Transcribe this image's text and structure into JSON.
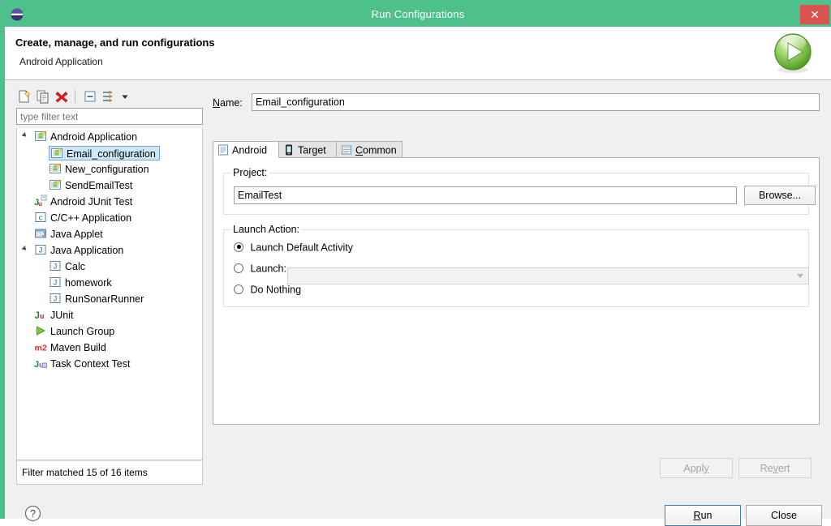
{
  "window": {
    "title": "Run Configurations",
    "app_icon": "eclipse-globe-icon",
    "close_label": "✕"
  },
  "banner": {
    "title": "Create, manage, and run configurations",
    "subtitle": "Android Application",
    "icon": "run-launch-icon"
  },
  "left_panel": {
    "toolbar": [
      {
        "name": "new-launch-configuration",
        "icon": "new-document-icon"
      },
      {
        "name": "duplicate-launch-configuration",
        "icon": "copy-icon"
      },
      {
        "name": "delete-launch-configuration",
        "icon": "red-x-delete-icon"
      },
      {
        "name": "collapse-all",
        "icon": "collapse-all-icon"
      },
      {
        "name": "filter-launch-configurations",
        "icon": "filter-icon"
      },
      {
        "name": "view-menu",
        "icon": "chevron-down-icon"
      }
    ],
    "filter": {
      "value": "type filter text",
      "placeholder": "type filter text"
    },
    "tree": [
      {
        "label": "Android Application",
        "icon": "android-config-icon",
        "indent": 0,
        "expanded": true,
        "selected": false
      },
      {
        "label": "Email_configuration",
        "icon": "android-config-icon",
        "indent": 1,
        "expanded": false,
        "selected": true
      },
      {
        "label": "New_configuration",
        "icon": "android-config-icon",
        "indent": 1,
        "expanded": false,
        "selected": false
      },
      {
        "label": "SendEmailTest",
        "icon": "android-config-icon",
        "indent": 1,
        "expanded": false,
        "selected": false
      },
      {
        "label": "Android JUnit Test",
        "icon": "android-junit-icon",
        "indent": 0,
        "expanded": false,
        "selected": false
      },
      {
        "label": "C/C++ Application",
        "icon": "c-application-icon",
        "indent": 0,
        "expanded": false,
        "selected": false
      },
      {
        "label": "Java Applet",
        "icon": "java-applet-icon",
        "indent": 0,
        "expanded": false,
        "selected": false
      },
      {
        "label": "Java Application",
        "icon": "java-application-icon",
        "indent": 0,
        "expanded": true,
        "selected": false
      },
      {
        "label": "Calc",
        "icon": "java-application-icon",
        "indent": 1,
        "expanded": false,
        "selected": false
      },
      {
        "label": "homework",
        "icon": "java-application-icon",
        "indent": 1,
        "expanded": false,
        "selected": false
      },
      {
        "label": "RunSonarRunner",
        "icon": "java-application-icon",
        "indent": 1,
        "expanded": false,
        "selected": false
      },
      {
        "label": "JUnit",
        "icon": "junit-icon",
        "indent": 0,
        "expanded": false,
        "selected": false
      },
      {
        "label": "Launch Group",
        "icon": "green-play-icon",
        "indent": 0,
        "expanded": false,
        "selected": false
      },
      {
        "label": "Maven Build",
        "icon": "maven-m2-icon",
        "indent": 0,
        "expanded": false,
        "selected": false
      },
      {
        "label": "Task Context Test",
        "icon": "task-context-junit-icon",
        "indent": 0,
        "expanded": false,
        "selected": false
      }
    ],
    "filter_status": "Filter matched 15 of 16 items"
  },
  "right_panel": {
    "name_label": "Name:",
    "name_label_mnemonic": "N",
    "name_value": "Email_configuration",
    "tabs": [
      {
        "label": "Android",
        "icon": "android-tab-icon",
        "active": true
      },
      {
        "label": "Target",
        "icon": "device-target-icon",
        "active": false
      },
      {
        "label": "Common",
        "icon": "common-tab-icon",
        "active": false,
        "mnemonic": "C"
      }
    ],
    "project_group": {
      "label": "Project:",
      "value": "EmailTest",
      "browse_label": "Browse..."
    },
    "launch_action_group": {
      "label": "Launch Action:",
      "options": [
        {
          "label": "Launch Default Activity",
          "checked": true
        },
        {
          "label": "Launch:",
          "checked": false
        },
        {
          "label": "Do Nothing",
          "checked": false
        }
      ],
      "launch_combo_value": "",
      "launch_combo_enabled": false
    },
    "apply_label": "Apply",
    "apply_mnemonic": "y",
    "apply_enabled": false,
    "revert_label": "Revert",
    "revert_mnemonic": "v",
    "revert_enabled": false
  },
  "footer": {
    "help_icon": "help-question-icon",
    "run_label": "Run",
    "run_mnemonic": "R",
    "close_label": "Close"
  },
  "colors": {
    "titlebar": "#4ec08c",
    "close_button": "#d9534f",
    "selection": "#cfe8f7",
    "selection_border": "#7da2ce",
    "default_button_border": "#3c7fb1"
  }
}
